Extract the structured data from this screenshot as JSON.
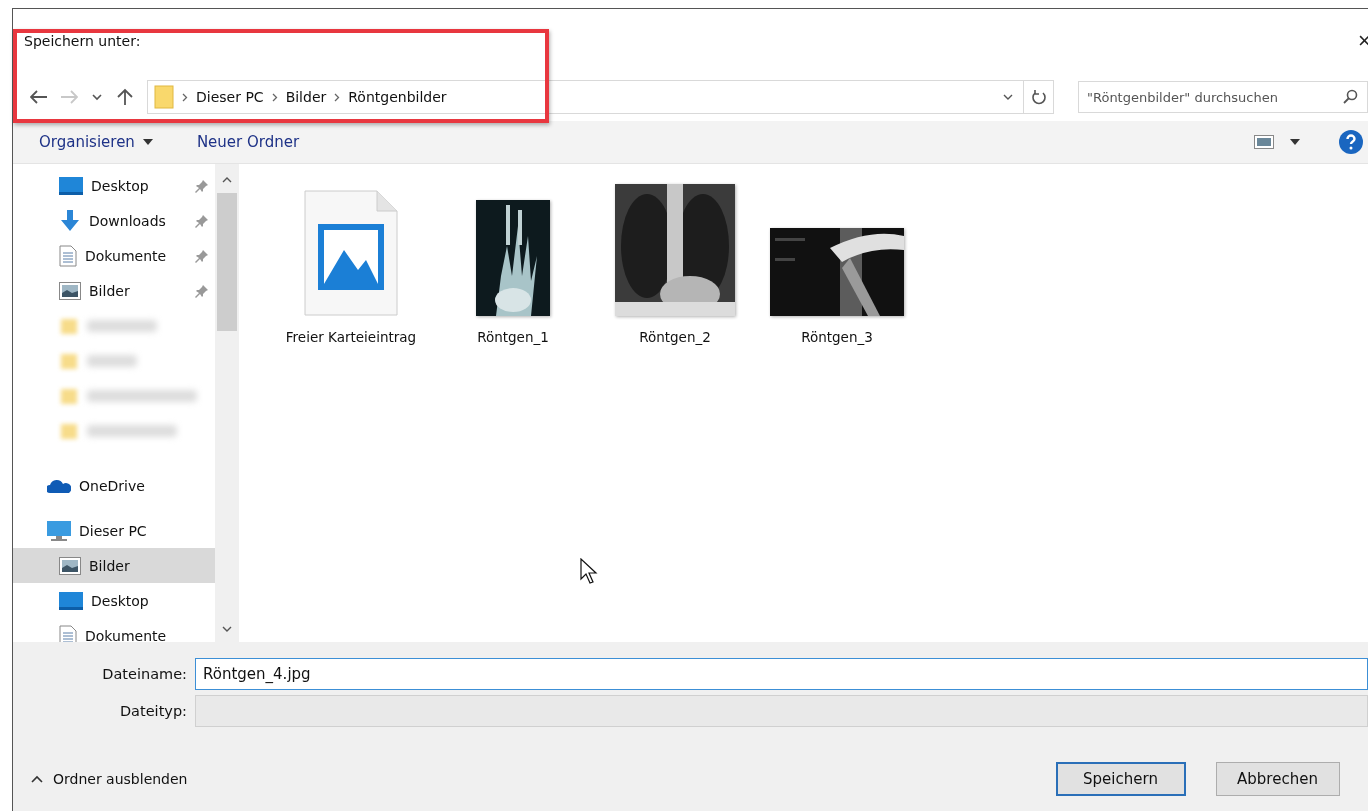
{
  "dialog": {
    "title": "Speichern unter:",
    "close": "×"
  },
  "nav_buttons": [
    {
      "kind": "back",
      "disabled": false
    },
    {
      "kind": "forward",
      "disabled": true
    },
    {
      "kind": "recent",
      "disabled": false
    },
    {
      "kind": "up",
      "disabled": false
    }
  ],
  "breadcrumb": [
    "Dieser PC",
    "Bilder",
    "Röntgenbilder"
  ],
  "search": {
    "placeholder": "\"Röntgenbilder\" durchsuchen"
  },
  "toolbar": {
    "organize": "Organisieren",
    "new_folder": "Neuer Ordner"
  },
  "sidebar": [
    {
      "children": [
        {
          "label": "Desktop",
          "kind": "desktop",
          "pinned": true,
          "selected": false
        },
        {
          "label": "Downloads",
          "kind": "download",
          "pinned": true,
          "selected": false
        },
        {
          "label": "Dokumente",
          "kind": "document",
          "pinned": true,
          "selected": false
        },
        {
          "label": "Bilder",
          "kind": "pictures",
          "pinned": true,
          "selected": false
        },
        {
          "kind": "blurred",
          "pinned": false,
          "selected": false
        },
        {
          "kind": "blurred",
          "pinned": false,
          "selected": false
        },
        {
          "kind": "blurred",
          "pinned": false,
          "selected": false
        },
        {
          "kind": "blurred",
          "pinned": false,
          "selected": false
        }
      ]
    },
    {
      "label": "OneDrive",
      "kind": "cloud",
      "selected": false
    },
    {
      "label": "Dieser PC",
      "kind": "pc",
      "selected": false,
      "children": [
        {
          "label": "Bilder",
          "kind": "pictures",
          "pinned": false,
          "selected": true
        },
        {
          "label": "Desktop",
          "kind": "desktop",
          "pinned": false,
          "selected": false
        },
        {
          "label": "Dokumente",
          "kind": "document",
          "pinned": false,
          "selected": false
        }
      ]
    }
  ],
  "files": [
    {
      "label": "Freier Karteieintrag",
      "kind": "document"
    },
    {
      "label": "Röntgen_1",
      "kind": "picture"
    },
    {
      "label": "Röntgen_2",
      "kind": "picture"
    },
    {
      "label": "Röntgen_3",
      "kind": "picture"
    }
  ],
  "form": {
    "filename_label": "Dateiname:",
    "filename": "Röntgen_4.jpg",
    "filetype_label": "Dateityp:",
    "filetype_disabled": true
  },
  "hide_folders": "Ordner ausblenden",
  "buttons": [
    {
      "label": "Speichern",
      "default": true
    },
    {
      "label": "Abbrechen",
      "default": false
    }
  ]
}
